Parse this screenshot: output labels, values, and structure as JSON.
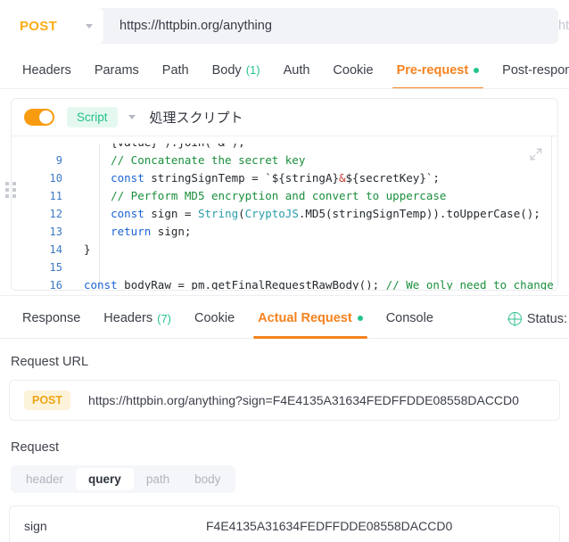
{
  "urlbar": {
    "method": "POST",
    "url": "https://httpbin.org/anything",
    "ghost": "ht"
  },
  "request_tabs": [
    {
      "label": "Headers",
      "count": "",
      "active": false,
      "dot": false
    },
    {
      "label": "Params",
      "count": "",
      "active": false,
      "dot": false
    },
    {
      "label": "Path",
      "count": "",
      "active": false,
      "dot": false
    },
    {
      "label": "Body",
      "count": "(1)",
      "active": false,
      "dot": false
    },
    {
      "label": "Auth",
      "count": "",
      "active": false,
      "dot": false
    },
    {
      "label": "Cookie",
      "count": "",
      "active": false,
      "dot": false
    },
    {
      "label": "Pre-request",
      "count": "",
      "active": true,
      "dot": true
    },
    {
      "label": "Post-response",
      "count": "",
      "active": false,
      "dot": false
    }
  ],
  "script_panel": {
    "toggle_on": true,
    "chip": "Script",
    "title": "処理スクリプト",
    "expand_icon": "expand-icon"
  },
  "code": {
    "clipped_top": "    {value}`).join('&');",
    "lines": [
      {
        "no": "9",
        "segments": [
          {
            "t": "    ",
            "c": "pl"
          },
          {
            "t": "// Concatenate the secret key",
            "c": "cm"
          }
        ]
      },
      {
        "no": "10",
        "segments": [
          {
            "t": "    ",
            "c": "pl"
          },
          {
            "t": "const",
            "c": "kw"
          },
          {
            "t": " stringSignTemp = `${stringA}",
            "c": "pl"
          },
          {
            "t": "&",
            "c": "op"
          },
          {
            "t": "${secretKey}`;",
            "c": "pl"
          }
        ]
      },
      {
        "no": "11",
        "segments": [
          {
            "t": "    ",
            "c": "pl"
          },
          {
            "t": "// Perform MD5 encryption and convert to uppercase",
            "c": "cm"
          }
        ]
      },
      {
        "no": "12",
        "segments": [
          {
            "t": "    ",
            "c": "pl"
          },
          {
            "t": "const",
            "c": "kw"
          },
          {
            "t": " sign = ",
            "c": "pl"
          },
          {
            "t": "String",
            "c": "fn"
          },
          {
            "t": "(",
            "c": "pl"
          },
          {
            "t": "CryptoJS",
            "c": "fn"
          },
          {
            "t": ".MD5(stringSignTemp)).toUpperCase();",
            "c": "pl"
          }
        ]
      },
      {
        "no": "13",
        "segments": [
          {
            "t": "    ",
            "c": "pl"
          },
          {
            "t": "return",
            "c": "kw"
          },
          {
            "t": " sign;",
            "c": "pl"
          }
        ]
      },
      {
        "no": "14",
        "segments": [
          {
            "t": "}",
            "c": "pl"
          }
        ]
      },
      {
        "no": "15",
        "segments": [
          {
            "t": "",
            "c": "pl"
          }
        ]
      },
      {
        "no": "16",
        "segments": [
          {
            "t": "const",
            "c": "kw"
          },
          {
            "t": " bodyRaw = pm.getFinalRequestRawBody(); ",
            "c": "pl"
          },
          {
            "t": "// We only need to change",
            "c": "cm"
          }
        ]
      }
    ]
  },
  "response_tabs": [
    {
      "label": "Response",
      "count": "",
      "active": false,
      "dot": false
    },
    {
      "label": "Headers",
      "count": "(7)",
      "active": false,
      "dot": false
    },
    {
      "label": "Cookie",
      "count": "",
      "active": false,
      "dot": false
    },
    {
      "label": "Actual Request",
      "count": "",
      "active": true,
      "dot": true
    },
    {
      "label": "Console",
      "count": "",
      "active": false,
      "dot": false
    }
  ],
  "status": {
    "icon": "globe-icon",
    "label": "Status:"
  },
  "actual_request": {
    "url_section_label": "Request URL",
    "method_pill": "POST",
    "full_url": "https://httpbin.org/anything?sign=F4E4135A31634FEDFFDDE08558DACCD0",
    "request_section_label": "Request",
    "segments": [
      {
        "label": "header",
        "active": false
      },
      {
        "label": "query",
        "active": true
      },
      {
        "label": "path",
        "active": false
      },
      {
        "label": "body",
        "active": false
      }
    ],
    "params": [
      {
        "key": "sign",
        "value": "F4E4135A31634FEDFFDDE08558DACCD0"
      }
    ]
  },
  "colors": {
    "accent_orange": "#f5821f",
    "method_yellow": "#fcad14",
    "green": "#23c58a",
    "code_keyword": "#1b63d6",
    "code_comment": "#1a8f3c",
    "line_number": "#3b79c4"
  }
}
